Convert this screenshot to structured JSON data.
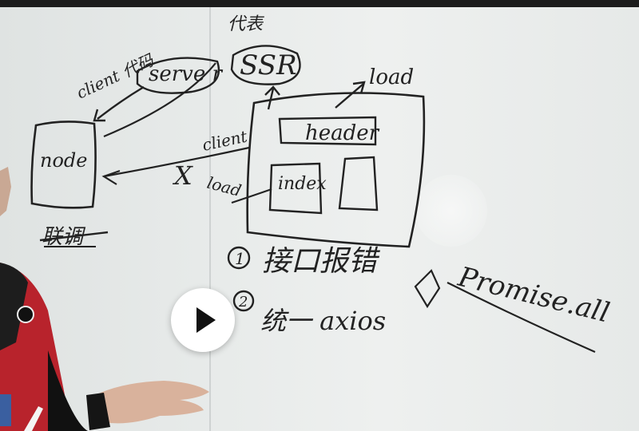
{
  "video": {
    "state": "paused",
    "controls": {
      "play_icon": "play-icon"
    }
  },
  "whiteboard": {
    "labels": {
      "daibiao_top": "代表",
      "ssr": "SSR",
      "server": "serve r",
      "client_proxy": "client 代码",
      "load_top": "load",
      "node": "node",
      "client_mid": "client",
      "header": "header",
      "load_left": "load",
      "index": "index",
      "test_struck": "联调",
      "item1": "接口报错",
      "item1_num": "1",
      "item2_num": "2",
      "item2": "统一 axios",
      "x_mark": "X",
      "circle_x": "⊗",
      "promise_all": "Promise.all"
    }
  },
  "colors": {
    "ink": "#222222",
    "board": "#e8ebea",
    "play_button": "#ffffff",
    "shirt_red": "#b8232c"
  }
}
